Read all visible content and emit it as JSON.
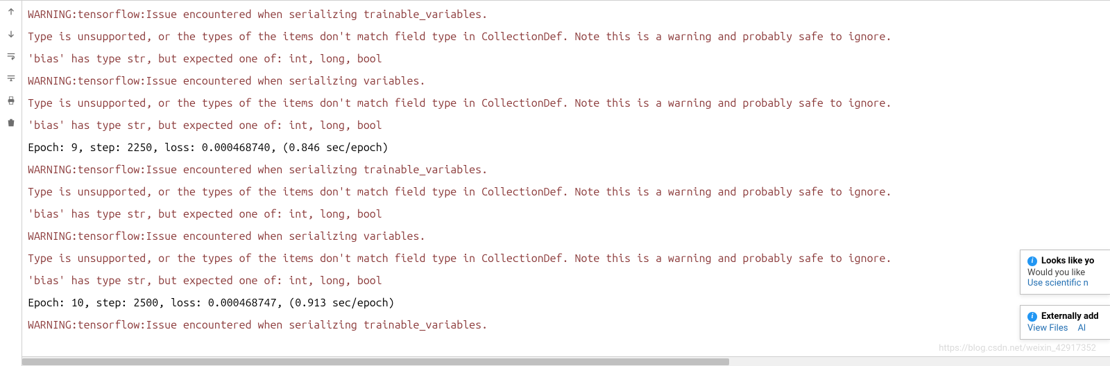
{
  "console": {
    "lines": [
      {
        "text": "WARNING:tensorflow:Issue encountered when serializing trainable_variables.",
        "cls": "warn"
      },
      {
        "text": "Type is unsupported, or the types of the items don't match field type in CollectionDef. Note this is a warning and probably safe to ignore.",
        "cls": "warn"
      },
      {
        "text": "'bias' has type str, but expected one of: int, long, bool",
        "cls": "warn"
      },
      {
        "text": "WARNING:tensorflow:Issue encountered when serializing variables.",
        "cls": "warn"
      },
      {
        "text": "Type is unsupported, or the types of the items don't match field type in CollectionDef. Note this is a warning and probably safe to ignore.",
        "cls": "warn"
      },
      {
        "text": "'bias' has type str, but expected one of: int, long, bool",
        "cls": "warn"
      },
      {
        "text": "Epoch: 9, step: 2250, loss: 0.000468740, (0.846 sec/epoch)",
        "cls": ""
      },
      {
        "text": "WARNING:tensorflow:Issue encountered when serializing trainable_variables.",
        "cls": "warn"
      },
      {
        "text": "Type is unsupported, or the types of the items don't match field type in CollectionDef. Note this is a warning and probably safe to ignore.",
        "cls": "warn"
      },
      {
        "text": "'bias' has type str, but expected one of: int, long, bool",
        "cls": "warn"
      },
      {
        "text": "WARNING:tensorflow:Issue encountered when serializing variables.",
        "cls": "warn"
      },
      {
        "text": "Type is unsupported, or the types of the items don't match field type in CollectionDef. Note this is a warning and probably safe to ignore.",
        "cls": "warn"
      },
      {
        "text": "'bias' has type str, but expected one of: int, long, bool",
        "cls": "warn"
      },
      {
        "text": "Epoch: 10, step: 2500, loss: 0.000468747, (0.913 sec/epoch)",
        "cls": ""
      },
      {
        "text": "WARNING:tensorflow:Issue encountered when serializing trainable_variables.",
        "cls": "warn"
      }
    ]
  },
  "notifications": {
    "scientific": {
      "title": "Looks like yo",
      "body": "Would you like",
      "link": "Use scientific n"
    },
    "external": {
      "title": "Externally add",
      "link1": "View Files",
      "link2": "Al"
    }
  },
  "watermark": "https://blog.csdn.net/weixin_42917352"
}
